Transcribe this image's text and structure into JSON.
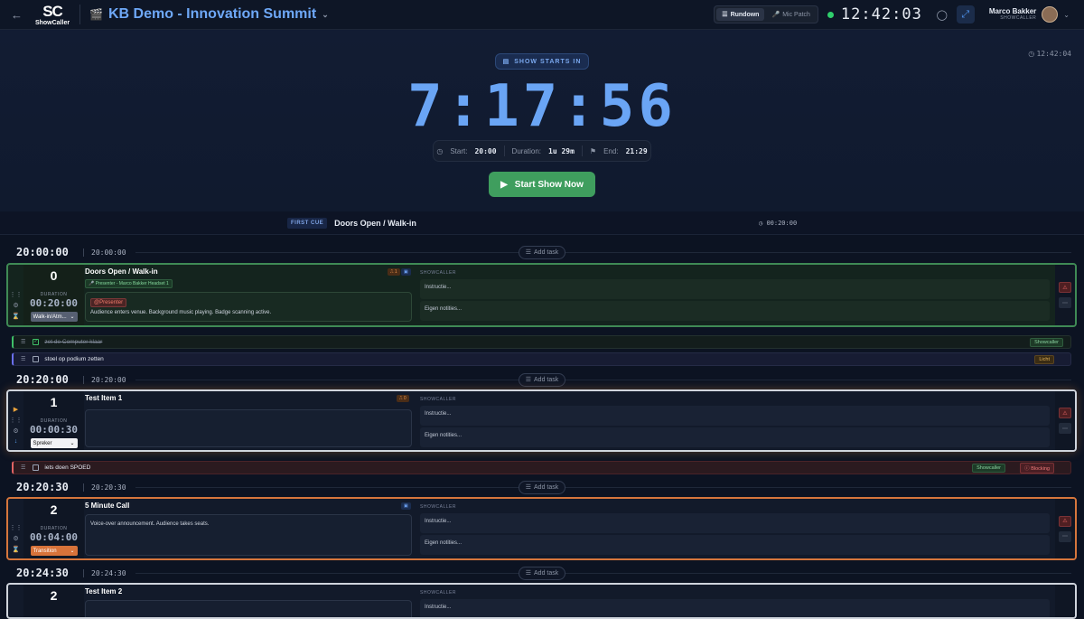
{
  "header": {
    "back_icon": "arrow-left-icon",
    "logo_text": "SC",
    "logo_sub": "ShowCaller",
    "show_title": "KB Demo - Innovation Summit",
    "tab_rundown": "Rundown",
    "tab_mic_patch": "Mic Patch",
    "clock": "12:42:03",
    "user_name": "Marco Bakker",
    "user_role": "SHOWCALLER"
  },
  "hero": {
    "label": "SHOW STARTS IN",
    "side_clock": "12:42:04",
    "countdown": "7:17:56",
    "start_label": "Start:",
    "start_value": "20:00",
    "duration_label": "Duration:",
    "duration_value": "1u 29m",
    "end_label": "End:",
    "end_value": "21:29",
    "start_button": "Start Show Now"
  },
  "first_cue": {
    "badge": "FIRST CUE",
    "name": "Doors Open / Walk-in",
    "time": "00:20:00"
  },
  "common": {
    "add_task": "Add task",
    "duration_label": "DURATION",
    "showcaller_label": "SHOWCALLER",
    "instructie": "Instructie...",
    "notities": "Eigen notities..."
  },
  "rows": {
    "r1_a": "20:00:00",
    "r1_b": "20:00:00",
    "r2_a": "20:20:00",
    "r2_b": "20:20:00",
    "r3_a": "20:20:30",
    "r3_b": "20:20:30",
    "r4_a": "20:24:30",
    "r4_b": "20:24:30"
  },
  "cues": [
    {
      "num": "0",
      "duration": "00:20:00",
      "type": "Walk-in/Atm...",
      "title": "Doors Open / Walk-in",
      "badge": "⎍ 1",
      "presenter": "Presenter - Marco Bakker",
      "headset": "Headset 1",
      "tag": "@Presenter",
      "text": "Audience enters venue. Background music playing. Badge scanning active."
    },
    {
      "num": "1",
      "duration": "00:00:30",
      "type": "Spreker",
      "title": "Test Item 1",
      "badge": "⎍ 0"
    },
    {
      "num": "2",
      "duration": "00:04:00",
      "type": "Transition",
      "title": "5 Minute Call",
      "text": "Voice-over announcement. Audience takes seats."
    },
    {
      "num": "2",
      "title": "Test Item 2"
    }
  ],
  "tasks": [
    {
      "text": "zet de Computer klaar",
      "tag": "Showcaller"
    },
    {
      "text": "stoel op podium zetten",
      "tag": "Licht"
    },
    {
      "text": "iets doen SPOED",
      "tag": "Showcaller",
      "tag2": "Blocking"
    }
  ]
}
